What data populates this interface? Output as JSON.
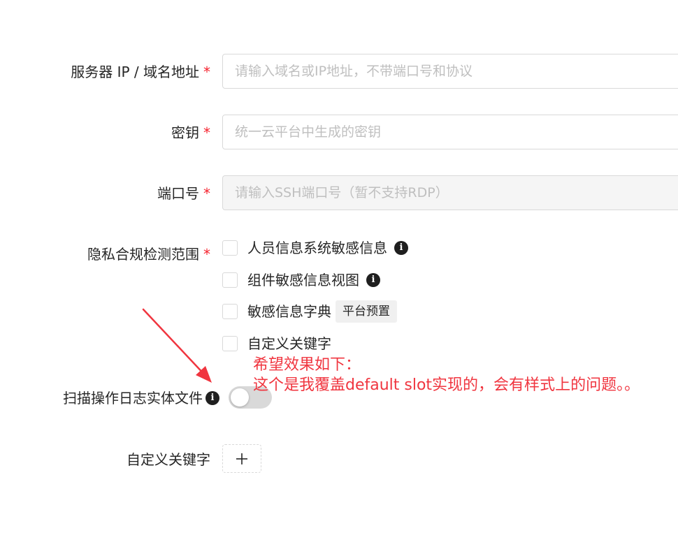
{
  "form": {
    "server": {
      "label": "服务器 IP / 域名地址",
      "required_mark": "*",
      "placeholder": "请输入域名或IP地址，不带端口号和协议"
    },
    "secret": {
      "label": "密钥",
      "required_mark": "*",
      "placeholder": "统一云平台中生成的密钥"
    },
    "port": {
      "label": "端口号",
      "required_mark": "*",
      "placeholder": "请输入SSH端口号（暂不支持RDP）"
    },
    "privacy": {
      "label": "隐私合规检测范围",
      "required_mark": "*",
      "options": [
        {
          "label": "人员信息系统敏感信息",
          "checked": false,
          "icon": "info-icon"
        },
        {
          "label": "组件敏感信息视图",
          "checked": false,
          "icon": "info-icon"
        },
        {
          "label": "敏感信息字典",
          "checked": false,
          "tag": "平台预置"
        },
        {
          "label": "自定义关键字",
          "checked": false
        }
      ]
    },
    "scan_log": {
      "label": "扫描操作日志实体文件",
      "icon": "info-icon",
      "switch_on": false
    },
    "custom_keywords": {
      "label": "自定义关键字",
      "add_icon": "plus-icon"
    }
  },
  "annotation": {
    "line1": "希望效果如下：",
    "line2": "这个是我覆盖default slot实现的，会有样式上的问题。。",
    "color": "#f0353f"
  }
}
